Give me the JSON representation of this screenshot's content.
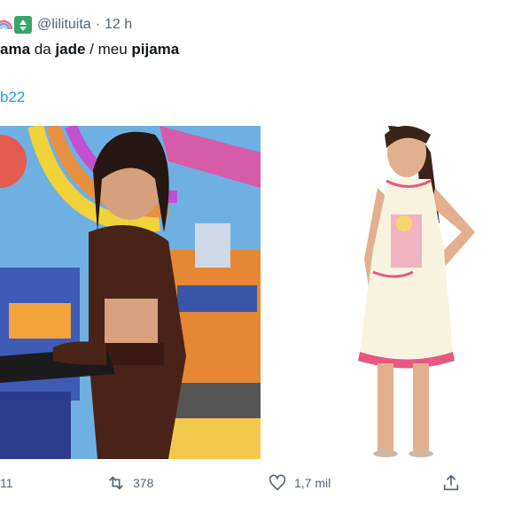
{
  "header": {
    "handle": "@lilituita",
    "separator": "·",
    "time": "12 h",
    "icons": [
      "rainbow-icon",
      "recycle-icon"
    ]
  },
  "tweet": {
    "parts": [
      {
        "text": "ama ",
        "bold": true
      },
      {
        "text": "da ",
        "bold": false
      },
      {
        "text": "jade",
        "bold": true
      },
      {
        "text": " / meu ",
        "bold": false
      },
      {
        "text": "pijama",
        "bold": true
      }
    ],
    "hashtag": "b22"
  },
  "actions": {
    "reply_count": "11",
    "retweet_count": "378",
    "like_count": "1,7 mil"
  },
  "colors": {
    "link": "#1d9bf0",
    "muted": "#536471"
  }
}
